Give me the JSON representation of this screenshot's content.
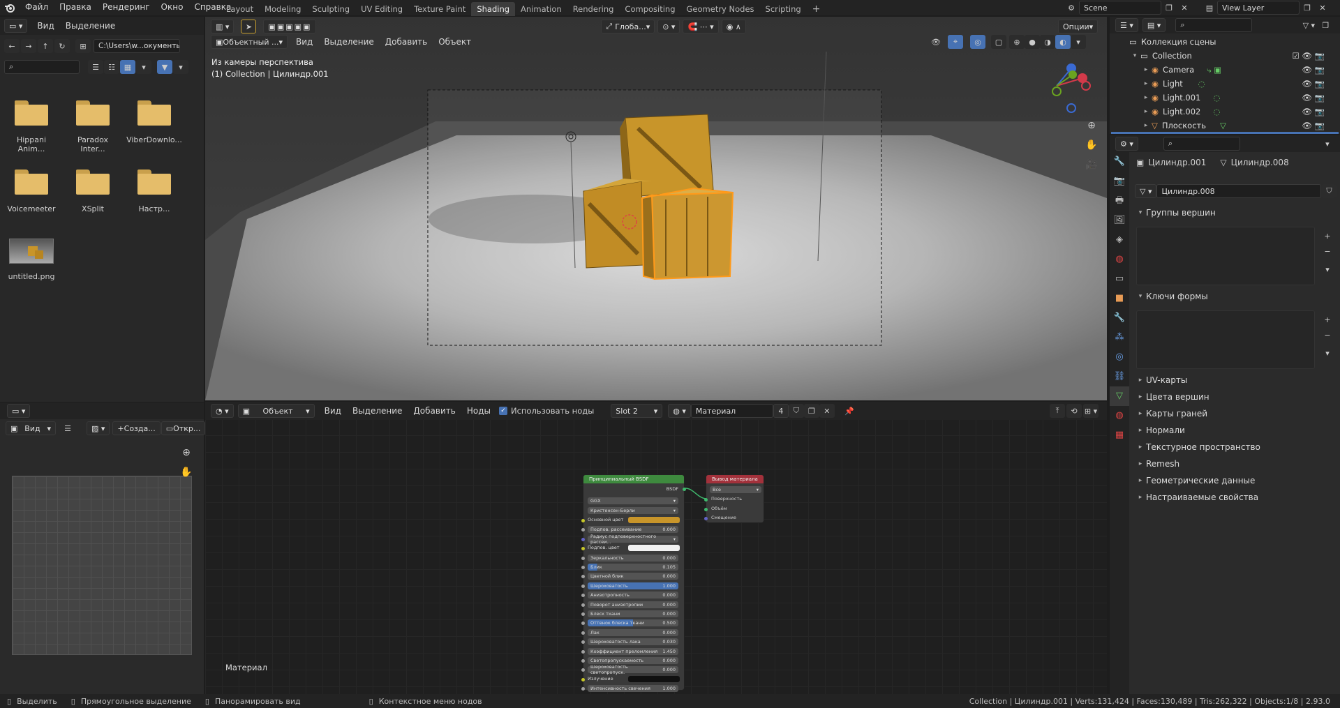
{
  "topbar": {
    "menus": [
      "Файл",
      "Правка",
      "Рендеринг",
      "Окно",
      "Справка"
    ],
    "workspaces": [
      "Layout",
      "Modeling",
      "Sculpting",
      "UV Editing",
      "Texture Paint",
      "Shading",
      "Animation",
      "Rendering",
      "Compositing",
      "Geometry Nodes",
      "Scripting"
    ],
    "active_workspace": "Shading",
    "scene": "Scene",
    "view_layer": "View Layer"
  },
  "file_browser": {
    "menus": [
      "Вид",
      "Выделение"
    ],
    "path": "C:\\Users\\w...окументы\\",
    "items": [
      {
        "name": "Hippani Anim...",
        "type": "folder"
      },
      {
        "name": "Paradox Inter...",
        "type": "folder"
      },
      {
        "name": "ViberDownlo...",
        "type": "folder"
      },
      {
        "name": "Voicemeeter",
        "type": "folder"
      },
      {
        "name": "XSplit",
        "type": "folder"
      },
      {
        "name": "Настр...",
        "type": "folder"
      },
      {
        "name": "untitled.png",
        "type": "image"
      }
    ]
  },
  "image_editor": {
    "view_label": "Вид",
    "new_label": "Созда...",
    "open_label": "Откр..."
  },
  "viewport": {
    "mode": "Объектный ...",
    "menus": [
      "Вид",
      "Выделение",
      "Добавить",
      "Объект"
    ],
    "transform": "Глоба...",
    "options": "Опции",
    "info_line1": "Из камеры перспектива",
    "info_line2": "(1) Collection | Цилиндр.001"
  },
  "outliner": {
    "root": "Коллекция сцены",
    "items": [
      {
        "name": "Collection",
        "level": 0
      },
      {
        "name": "Camera",
        "level": 1
      },
      {
        "name": "Light",
        "level": 1
      },
      {
        "name": "Light.001",
        "level": 1
      },
      {
        "name": "Light.002",
        "level": 1
      },
      {
        "name": "Плоскость",
        "level": 1
      }
    ]
  },
  "properties": {
    "object": "Цилиндр.001",
    "mesh": "Цилиндр.008",
    "mesh_field": "Цилиндр.008",
    "sections_open": [
      "Группы вершин",
      "Ключи формы"
    ],
    "sections_closed": [
      "UV-карты",
      "Цвета вершин",
      "Карты граней",
      "Нормали",
      "Текстурное пространство",
      "Remesh",
      "Геометрические данные",
      "Настраиваемые свойства"
    ]
  },
  "node_editor": {
    "object_mode": "Объект",
    "menus": [
      "Вид",
      "Выделение",
      "Добавить",
      "Ноды"
    ],
    "use_nodes": "Использовать ноды",
    "slot": "Slot 2",
    "material": "Материал",
    "users": "4",
    "label": "Материал",
    "bsdf_node": {
      "title": "Принципиальный BSDF",
      "output": "BSDF",
      "dist": "GGX",
      "sss": "Кристенсен-Берли",
      "fields": [
        {
          "label": "Основной цвет",
          "value": ""
        },
        {
          "label": "Подпов. рассеивание",
          "value": "0.000"
        },
        {
          "label": "Радиус подповерхностного рассеи...",
          "value": ""
        },
        {
          "label": "Подпов. цвет",
          "value": ""
        },
        {
          "label": "Зеркальность",
          "value": "0.000"
        },
        {
          "label": "Блик",
          "value": "0.105"
        },
        {
          "label": "Цветной блик",
          "value": "0.000"
        },
        {
          "label": "Шероховатость",
          "value": "1.000"
        },
        {
          "label": "Анизотропность",
          "value": "0.000"
        },
        {
          "label": "Поворот анизотропии",
          "value": "0.000"
        },
        {
          "label": "Блеск ткани",
          "value": "0.000"
        },
        {
          "label": "Оттенок блеска ткани",
          "value": "0.500"
        },
        {
          "label": "Лак",
          "value": "0.000"
        },
        {
          "label": "Шероховатость лака",
          "value": "0.030"
        },
        {
          "label": "Коэффициент преломления",
          "value": "1.450"
        },
        {
          "label": "Светопропускаемость",
          "value": "0.000"
        },
        {
          "label": "Шероховатость светопропуск.",
          "value": "0.000"
        },
        {
          "label": "Излучение",
          "value": ""
        },
        {
          "label": "Интенсивность свечения",
          "value": "1.000"
        }
      ]
    },
    "output_node": {
      "title": "Вывод материала",
      "target": "Все",
      "inputs": [
        "Поверхность",
        "Объём",
        "Смещение"
      ]
    }
  },
  "statusbar": {
    "select": "Выделить",
    "box_select": "Прямоугольное выделение",
    "pan": "Панорамировать вид",
    "context": "Контекстное меню нодов",
    "stats": "Collection | Цилиндр.001 | Verts:131,424 | Faces:130,489 | Tris:262,322 | Objects:1/8 | 2.93.0"
  },
  "colors": {
    "accent": "#4772b3",
    "crate": "#c8952a",
    "node_bsdf_header": "#3e8a3e",
    "node_output_header": "#a3313b"
  }
}
